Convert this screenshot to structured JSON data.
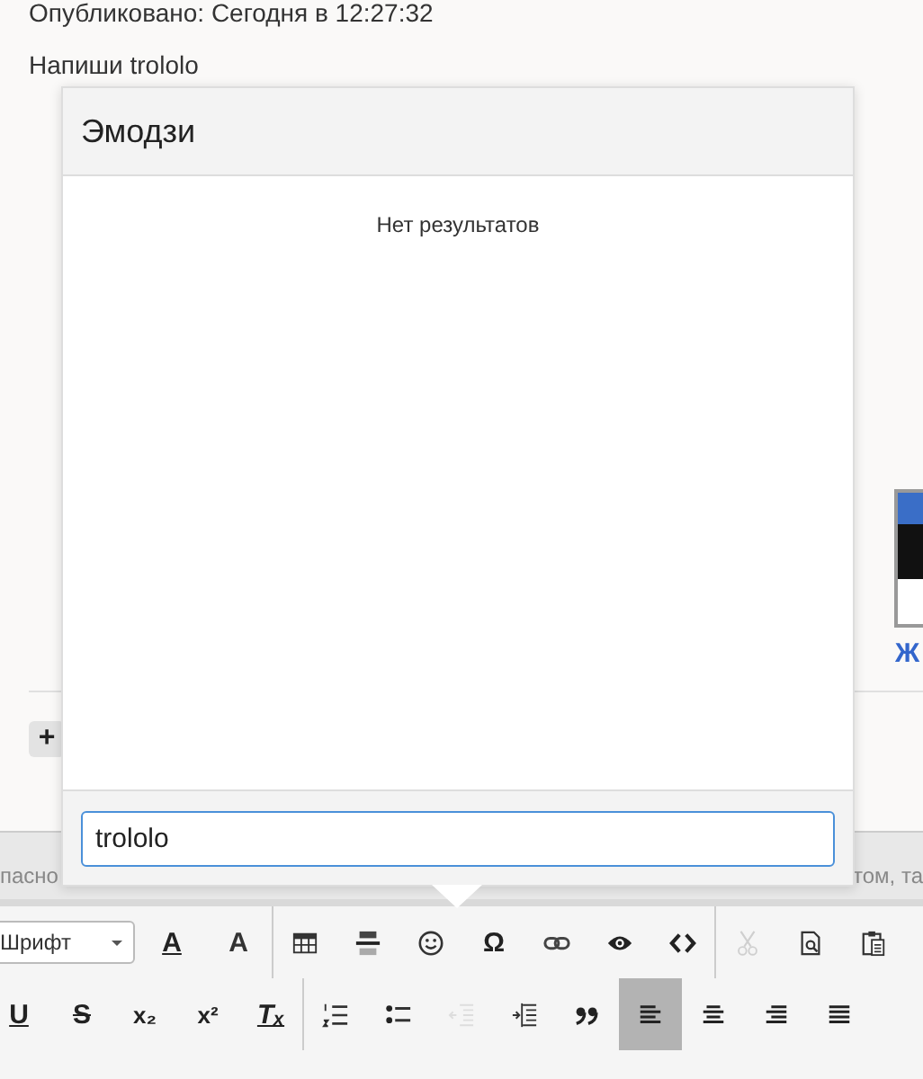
{
  "post": {
    "meta": "Опубликовано: Сегодня в 12:27:32",
    "text": "Напиши trololo"
  },
  "attachment": {
    "link": "Ж"
  },
  "add_button": {
    "label": "+"
  },
  "notice": {
    "left": "пасно",
    "right": "том, та"
  },
  "emoji_popup": {
    "title": "Эмодзи",
    "empty": "Нет результатов",
    "search_value": "trololo"
  },
  "toolbar": {
    "font": "Шрифт",
    "rows": [
      [
        {
          "kind": "text-color",
          "glyph": "A",
          "disabled": false,
          "selected": false
        },
        {
          "kind": "background-color",
          "glyph": "A",
          "disabled": false,
          "selected": false
        },
        {
          "kind": "separator"
        },
        {
          "kind": "table",
          "disabled": false,
          "selected": false
        },
        {
          "kind": "horizontal-line",
          "disabled": false,
          "selected": false
        },
        {
          "kind": "smiley",
          "disabled": false,
          "selected": false
        },
        {
          "kind": "special-character",
          "glyph": "Ω",
          "disabled": false,
          "selected": false
        },
        {
          "kind": "link",
          "disabled": false,
          "selected": false
        },
        {
          "kind": "eye",
          "disabled": false,
          "selected": false
        },
        {
          "kind": "code",
          "disabled": false,
          "selected": false
        },
        {
          "kind": "separator"
        },
        {
          "kind": "cut",
          "disabled": true,
          "selected": false
        },
        {
          "kind": "preview",
          "disabled": false,
          "selected": false
        },
        {
          "kind": "paste",
          "disabled": false,
          "selected": false
        }
      ],
      [
        {
          "kind": "underline",
          "glyph": "U",
          "disabled": false,
          "selected": false
        },
        {
          "kind": "strikethrough",
          "glyph": "S",
          "disabled": false,
          "selected": false
        },
        {
          "kind": "subscript",
          "glyph": "x₂",
          "disabled": false,
          "selected": false
        },
        {
          "kind": "superscript",
          "glyph": "x²",
          "disabled": false,
          "selected": false
        },
        {
          "kind": "clear-format",
          "glyph": "Tₓ",
          "disabled": false,
          "selected": false
        },
        {
          "kind": "separator"
        },
        {
          "kind": "numbered-list",
          "disabled": false,
          "selected": false
        },
        {
          "kind": "bullet-list",
          "disabled": false,
          "selected": false
        },
        {
          "kind": "outdent",
          "disabled": true,
          "selected": false
        },
        {
          "kind": "indent",
          "disabled": false,
          "selected": false
        },
        {
          "kind": "quote",
          "disabled": false,
          "selected": false
        },
        {
          "kind": "align-left",
          "disabled": false,
          "selected": true
        },
        {
          "kind": "align-center",
          "disabled": false,
          "selected": false
        },
        {
          "kind": "align-right",
          "disabled": false,
          "selected": false
        },
        {
          "kind": "align-justify",
          "disabled": false,
          "selected": false
        }
      ]
    ]
  }
}
